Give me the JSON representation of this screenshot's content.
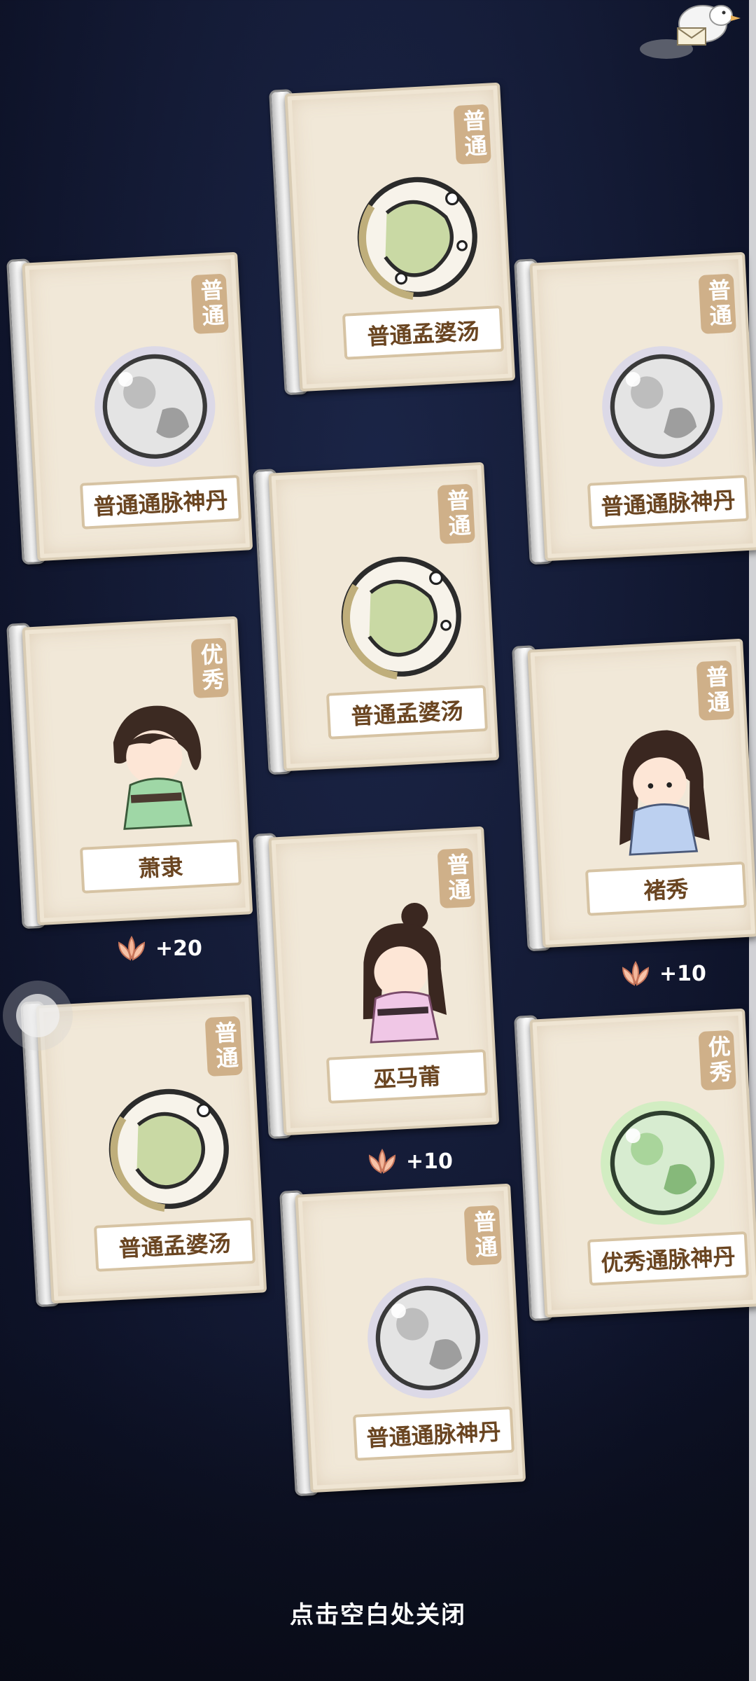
{
  "cards": [
    {
      "rarity": "普通",
      "name": "普通孟婆汤",
      "kind": "soup"
    },
    {
      "rarity": "普通",
      "name": "普通通脉神丹",
      "kind": "pill-white"
    },
    {
      "rarity": "普通",
      "name": "普通通脉神丹",
      "kind": "pill-white"
    },
    {
      "rarity": "普通",
      "name": "普通孟婆汤",
      "kind": "soup"
    },
    {
      "rarity": "优秀",
      "name": "萧隶",
      "kind": "char-green"
    },
    {
      "rarity": "普通",
      "name": "褚秀",
      "kind": "char-blue"
    },
    {
      "rarity": "普通",
      "name": "巫马莆",
      "kind": "char-pink"
    },
    {
      "rarity": "普通",
      "name": "普通孟婆汤",
      "kind": "soup"
    },
    {
      "rarity": "优秀",
      "name": "优秀通脉神丹",
      "kind": "pill-green"
    },
    {
      "rarity": "普通",
      "name": "普通通脉神丹",
      "kind": "pill-white"
    }
  ],
  "bonuses": [
    "+20",
    "+10",
    "+10"
  ],
  "close_tip": "点击空白处关闭",
  "colors": {
    "background": "#141b36",
    "paper": "#f1e8d8",
    "tag": "#cfb089",
    "name_text": "#6a4521"
  }
}
